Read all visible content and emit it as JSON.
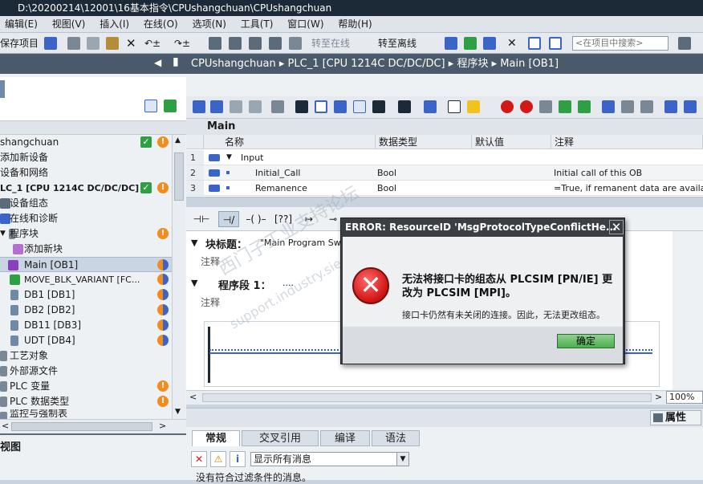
{
  "titlebar": {
    "title": "D:\\20200214\\12001\\16基本指令\\CPUshangchuan\\CPUshangchuan"
  },
  "menu": [
    "编辑(E)",
    "视图(V)",
    "插入(I)",
    "在线(O)",
    "选项(N)",
    "工具(T)",
    "窗口(W)",
    "帮助(H)"
  ],
  "toolbar": {
    "save_label": "保存项目",
    "go_online_label": "转至在线",
    "go_offline_label": "转至离线",
    "search_placeholder": "<在项目中搜索>"
  },
  "breadcrumb": [
    "CPUshangchuan",
    "PLC_1 [CPU 1214C DC/DC/DC]",
    "程序块",
    "Main [OB1]"
  ],
  "tree": [
    {
      "label": "shangchuan",
      "status": "ok-warn"
    },
    {
      "label": "添加新设备",
      "status": ""
    },
    {
      "label": "设备和网络",
      "status": ""
    },
    {
      "label": "LC_1 [CPU 1214C DC/DC/DC]",
      "status": "ok-warn"
    },
    {
      "label": "设备组态",
      "status": ""
    },
    {
      "label": "在线和诊断",
      "status": ""
    },
    {
      "label": "程序块",
      "status": "warn"
    },
    {
      "label": "添加新块",
      "status": ""
    },
    {
      "label": "Main [OB1]",
      "status": "half"
    },
    {
      "label": "MOVE_BLK_VARIANT [FC...",
      "status": "half"
    },
    {
      "label": "DB1 [DB1]",
      "status": "half"
    },
    {
      "label": "DB2 [DB2]",
      "status": "half"
    },
    {
      "label": "DB11 [DB3]",
      "status": "half"
    },
    {
      "label": "UDT [DB4]",
      "status": "half"
    },
    {
      "label": "工艺对象",
      "status": ""
    },
    {
      "label": "外部源文件",
      "status": ""
    },
    {
      "label": "PLC 变量",
      "status": "warn"
    },
    {
      "label": "PLC 数据类型",
      "status": "warn"
    },
    {
      "label": "监控与强制表",
      "status": ""
    }
  ],
  "left_bottom_label": "视图",
  "block": {
    "name": "Main"
  },
  "interface": {
    "headers": [
      "名称",
      "数据类型",
      "默认值",
      "注释"
    ],
    "rows": [
      {
        "num": "1",
        "name": "Input",
        "type": "",
        "default": "",
        "comment": ""
      },
      {
        "num": "2",
        "name": "Initial_Call",
        "type": "Bool",
        "default": "",
        "comment": "Initial call of this OB"
      },
      {
        "num": "3",
        "name": "Remanence",
        "type": "Bool",
        "default": "",
        "comment": "=True, if remanent data are availa"
      }
    ]
  },
  "ladder": {
    "block_title_label": "块标题：",
    "block_title_value": "\"Main Program Sw",
    "comment_label": "注释",
    "network_label": "程序段 1：",
    "network_value": "....",
    "network_comment": "注释"
  },
  "zoom": "100%",
  "props": {
    "title": "属性",
    "tabs": [
      "常规",
      "交叉引用",
      "编译",
      "语法"
    ],
    "filter": "显示所有消息",
    "status": "没有符合过滤条件的消息。"
  },
  "dialog": {
    "title": "ERROR: ResourceID 'MsgProtocolTypeConflictHe...",
    "message": "无法将接口卡的组态从 PLCSIM [PN/IE] 更改为 PLCSIM [MPI]。",
    "detail": "接口卡仍然有未关闭的连接。因此，无法更改组态。",
    "ok_label": "确定",
    "close_glyph": "✕"
  },
  "watermark": [
    "西门子工业支持论坛",
    "support.industry.siemens.com/cs"
  ],
  "colors": {
    "ok": "#2ea043",
    "warn": "#f28c1e",
    "error": "#d41818",
    "header": "#4a5a6a"
  }
}
